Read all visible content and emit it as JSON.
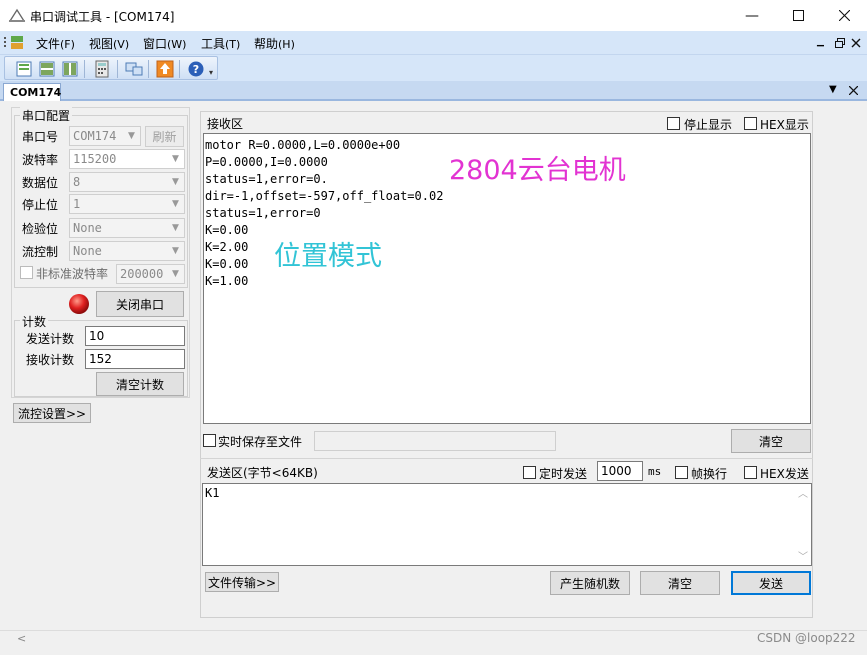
{
  "window": {
    "title": "串口调试工具 - [COM174]"
  },
  "menu": [
    {
      "label": "文件",
      "acc": "(F)"
    },
    {
      "label": "视图",
      "acc": "(V)"
    },
    {
      "label": "窗口",
      "acc": "(W)"
    },
    {
      "label": "工具",
      "acc": "(T)"
    },
    {
      "label": "帮助",
      "acc": "(H)"
    }
  ],
  "tabs": [
    "COM174"
  ],
  "serial_config": {
    "title": "串口配置",
    "port": {
      "label": "串口号",
      "value": "COM174"
    },
    "refresh_label": "刷新",
    "baud": {
      "label": "波特率",
      "value": "115200"
    },
    "databits": {
      "label": "数据位",
      "value": "8"
    },
    "stopbits": {
      "label": "停止位",
      "value": "1"
    },
    "parity": {
      "label": "检验位",
      "value": "None"
    },
    "flow": {
      "label": "流控制",
      "value": "None"
    },
    "nonstd": {
      "label": "非标准波特率",
      "value": "200000"
    },
    "close_port_label": "关闭串口",
    "status_color": "#e02020"
  },
  "counter": {
    "title": "计数",
    "send_label": "发送计数",
    "send_value": "10",
    "recv_label": "接收计数",
    "recv_value": "152",
    "clear_label": "清空计数"
  },
  "flow_settings_label": "流控设置>>",
  "receive": {
    "title": "接收区",
    "stop_display_label": "停止显示",
    "hex_display_label": "HEX显示",
    "lines": [
      "motor R=0.0000,L=0.0000e+00",
      "P=0.0000,I=0.0000",
      "status=1,error=0.",
      "dir=-1,offset=-597,off_float=0.02",
      "status=1,error=0",
      "K=0.00",
      "K=2.00",
      "K=0.00",
      "K=1.00"
    ],
    "annotation_1": "2804云台电机",
    "annotation_2": "位置模式",
    "save_to_file_label": "实时保存至文件",
    "clear_label": "清空"
  },
  "send": {
    "title": "发送区(字节<64KB)",
    "timed_label": "定时发送",
    "interval": "1000",
    "interval_unit": "ms",
    "newline_label": "帧换行",
    "hex_send_label": "HEX发送",
    "text": "K1",
    "file_transfer_label": "文件传输>>",
    "random_label": "产生随机数",
    "clear_label": "清空",
    "send_label": "发送"
  },
  "watermark": "CSDN @loop222"
}
